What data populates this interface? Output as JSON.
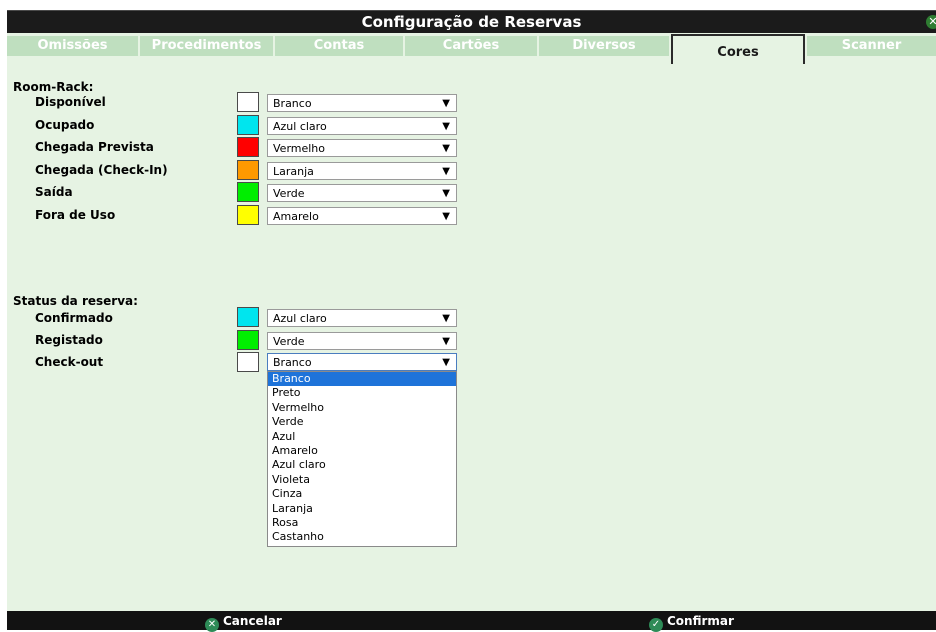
{
  "window": {
    "title": "Configuração de Reservas"
  },
  "tabs": [
    "Omissões",
    "Procedimentos",
    "Contas",
    "Cartões",
    "Diversos",
    "Cores",
    "Scanner"
  ],
  "active_tab": "Cores",
  "room_rack": {
    "label": "Room-Rack:",
    "rows": [
      {
        "label": "Disponível",
        "color": "#ffffff",
        "value": "Branco"
      },
      {
        "label": "Ocupado",
        "color": "#00e5ee",
        "value": "Azul claro"
      },
      {
        "label": "Chegada Prevista",
        "color": "#ff0000",
        "value": "Vermelho"
      },
      {
        "label": "Chegada (Check-In)",
        "color": "#ff9900",
        "value": "Laranja"
      },
      {
        "label": "Saída",
        "color": "#00ee00",
        "value": "Verde"
      },
      {
        "label": "Fora de Uso",
        "color": "#ffff00",
        "value": "Amarelo"
      }
    ]
  },
  "status_reserva": {
    "label": "Status da reserva:",
    "rows": [
      {
        "label": "Confirmado",
        "color": "#00e5ee",
        "value": "Azul claro"
      },
      {
        "label": "Registado",
        "color": "#00ee00",
        "value": "Verde"
      },
      {
        "label": "Check-out",
        "color": "#ffffff",
        "value": "Branco"
      }
    ]
  },
  "dropdown_options": [
    "Branco",
    "Preto",
    "Vermelho",
    "Verde",
    "Azul",
    "Amarelo",
    "Azul claro",
    "Violeta",
    "Cinza",
    "Laranja",
    "Rosa",
    "Castanho"
  ],
  "dropdown_selected": "Branco",
  "footer": {
    "cancel": "Cancelar",
    "confirm": "Confirmar"
  },
  "icons": {
    "close": "close-icon",
    "cancel": "cancel-icon",
    "confirm": "check-icon"
  }
}
